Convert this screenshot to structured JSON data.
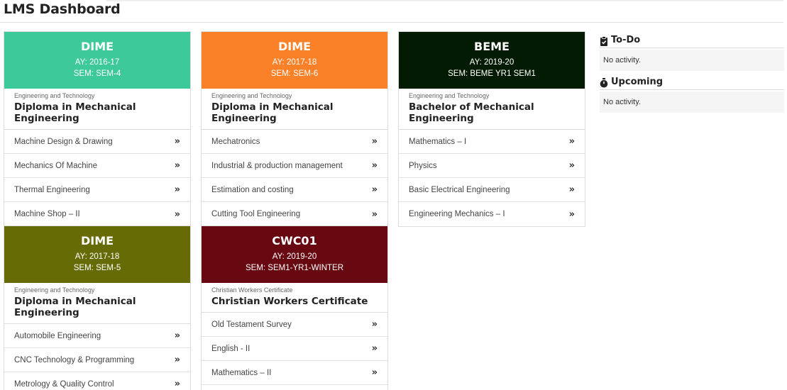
{
  "page": {
    "title": "LMS Dashboard"
  },
  "cards": [
    {
      "code": "DIME",
      "ay": "AY: 2016-17",
      "sem": "SEM: SEM-4",
      "color": "#3ec99b",
      "department": "Engineering and Technology",
      "program": "Diploma in Mechanical Engineering",
      "courses": [
        "Machine Design & Drawing",
        "Mechanics Of Machine",
        "Thermal Engineering",
        "Machine Shop – II"
      ]
    },
    {
      "code": "DIME",
      "ay": "AY: 2017-18",
      "sem": "SEM: SEM-6",
      "color": "#fb8128",
      "department": "Engineering and Technology",
      "program": "Diploma in Mechanical Engineering",
      "courses": [
        "Mechatronics",
        "Industrial & production management",
        "Estimation and costing",
        "Cutting Tool Engineering"
      ]
    },
    {
      "code": "BEME",
      "ay": "AY: 2019-20",
      "sem": "SEM: BEME YR1 SEM1",
      "color": "#041b03",
      "department": "Engineering and Technology",
      "program": "Bachelor of Mechanical Engineering",
      "courses": [
        "Mathematics – I",
        "Physics",
        "Basic Electrical Engineering",
        "Engineering Mechanics – I"
      ]
    },
    {
      "code": "DIME",
      "ay": "AY: 2017-18",
      "sem": "SEM: SEM-5",
      "color": "#666b06",
      "department": "Engineering and Technology",
      "program": "Diploma in Mechanical Engineering",
      "courses": [
        "Automobile Engineering",
        "CNC Technology & Programming",
        "Metrology & Quality Control"
      ]
    },
    {
      "code": "CWC01",
      "ay": "AY: 2019-20",
      "sem": "SEM: SEM1-YR1-WINTER",
      "color": "#680810",
      "department": "Christian Workers Certificate",
      "program": "Christian Workers Certificate",
      "courses": [
        "Old Testament Survey",
        "English - II",
        "Mathematics – II"
      ]
    }
  ],
  "sidebar": {
    "todo": {
      "title": "To-Do",
      "icon": "clipboard-check-icon",
      "empty_text": "No activity."
    },
    "upcoming": {
      "title": "Upcoming",
      "icon": "stopwatch-icon",
      "empty_text": "No activity."
    }
  },
  "icons": {
    "course_link": "»"
  }
}
